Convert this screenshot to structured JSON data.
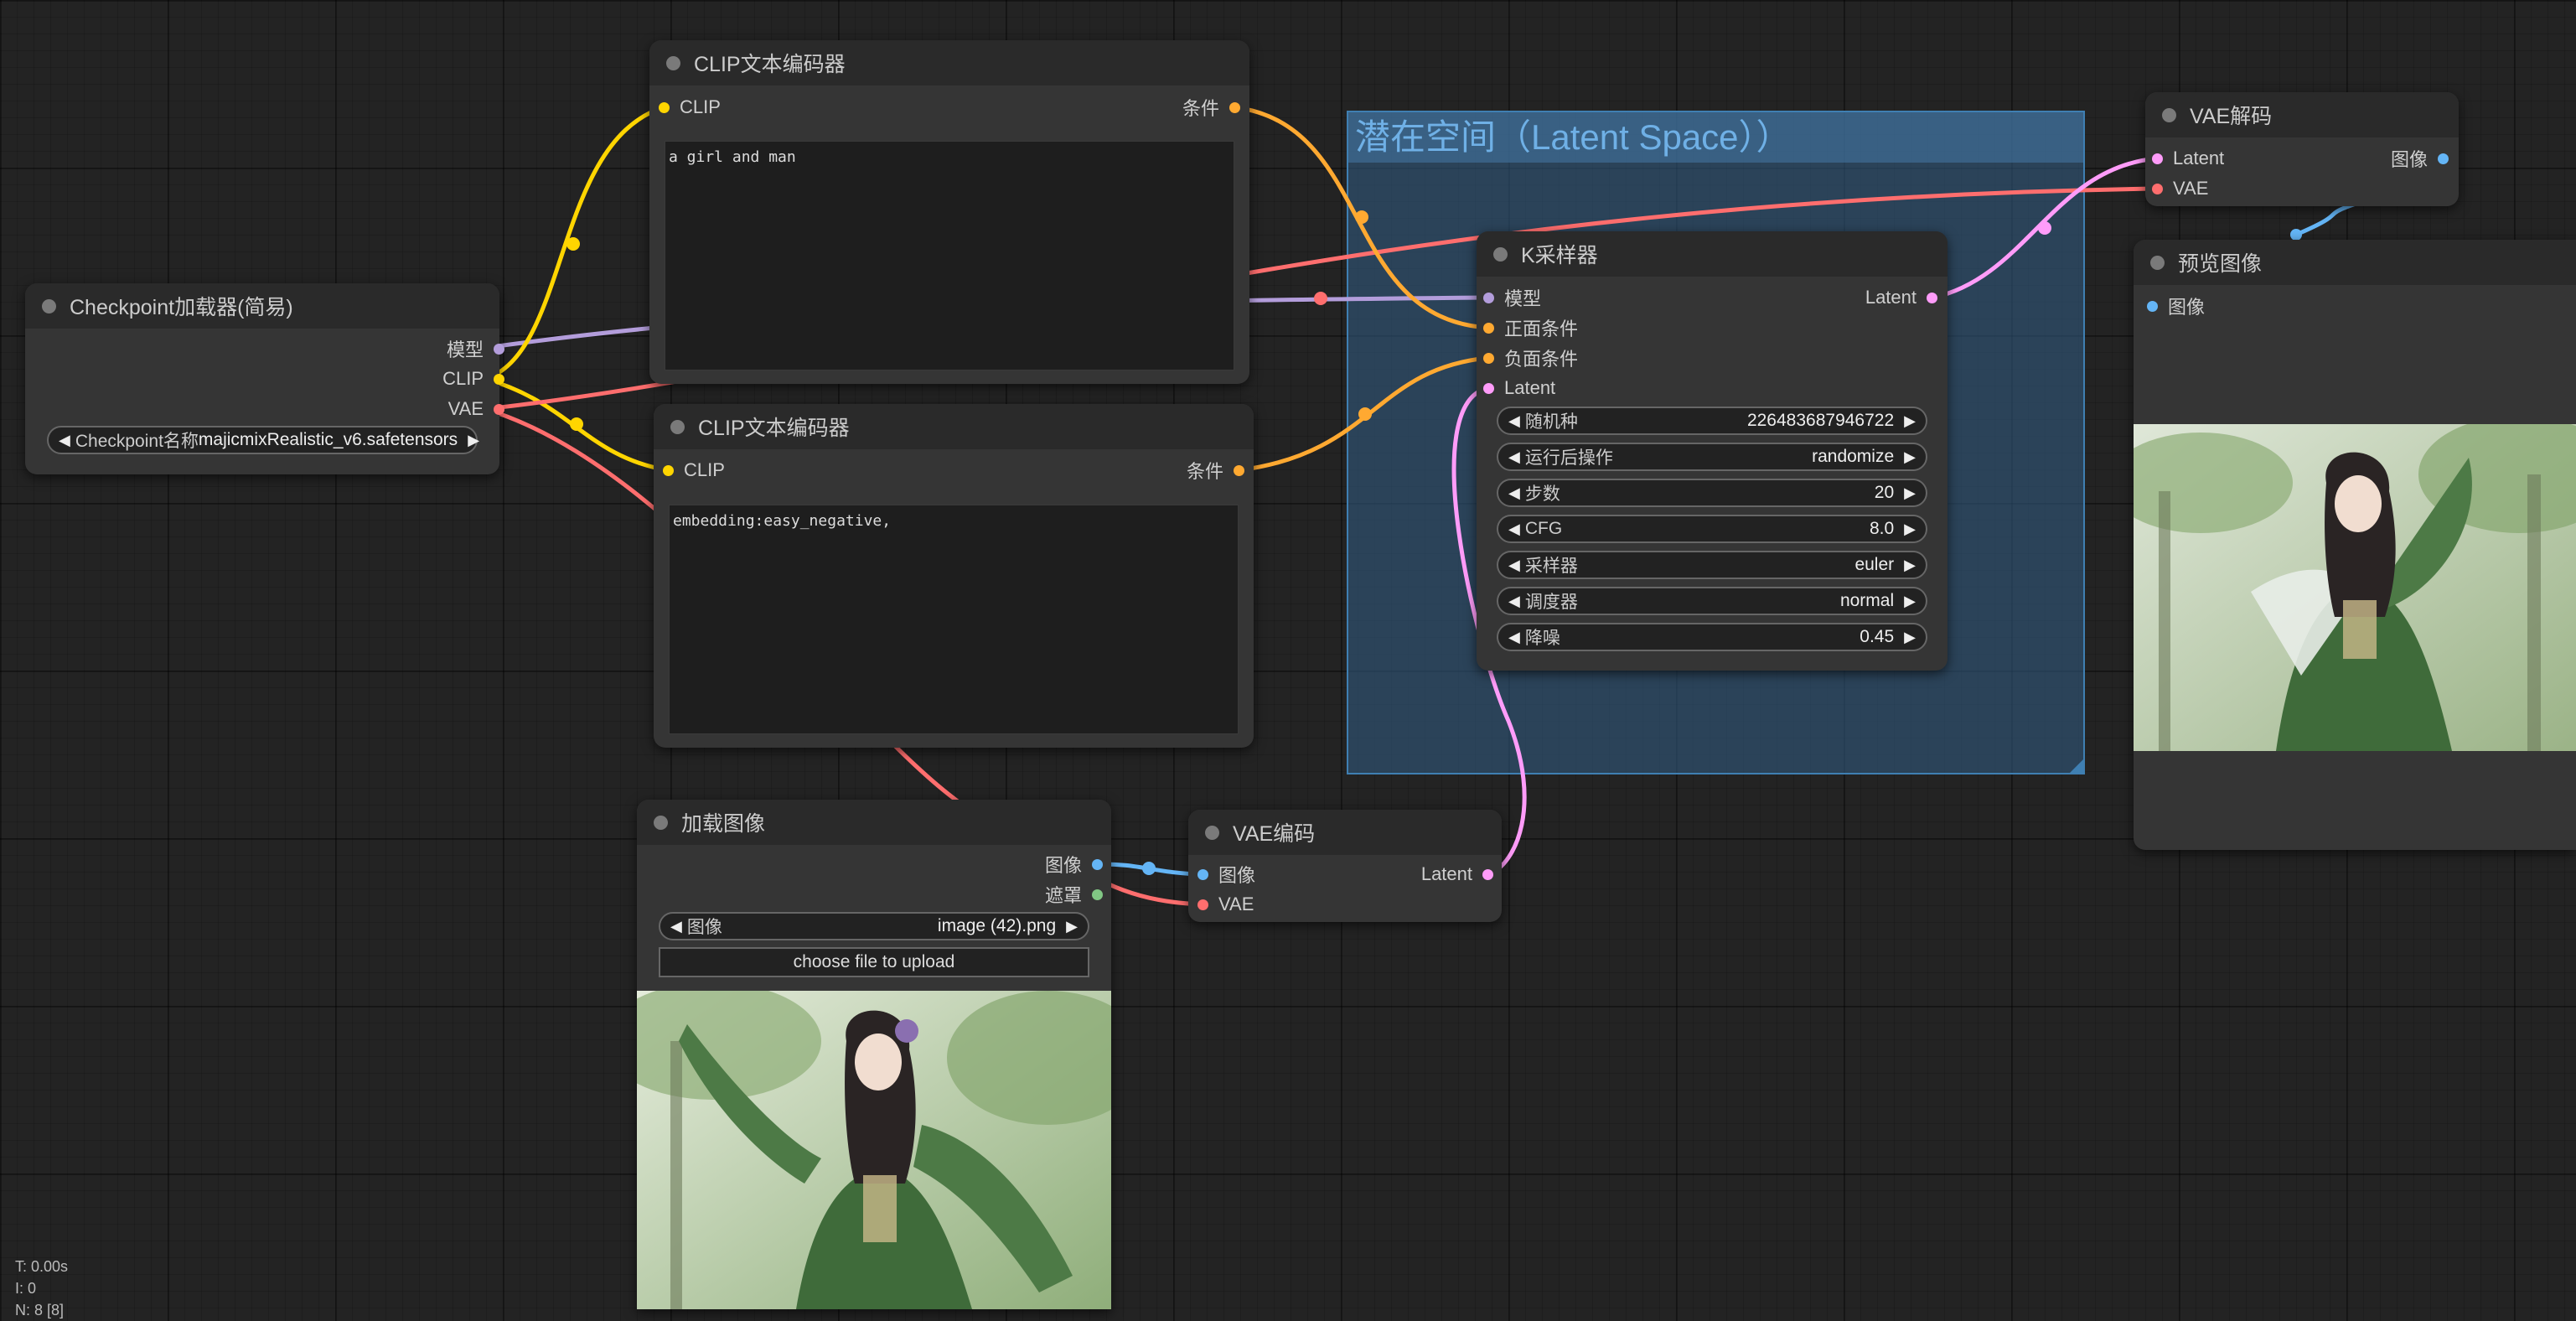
{
  "group": {
    "title": "潜在空间（Latent Space））"
  },
  "nodes": {
    "checkpoint": {
      "title": "Checkpoint加载器(简易)",
      "outputs": [
        "模型",
        "CLIP",
        "VAE"
      ],
      "widget": {
        "label": "Checkpoint名称",
        "value": "majicmixRealistic_v6.safetensors"
      }
    },
    "clip_pos": {
      "title": "CLIP文本编码器",
      "input": "CLIP",
      "output": "条件",
      "text": "a girl and man"
    },
    "clip_neg": {
      "title": "CLIP文本编码器",
      "input": "CLIP",
      "output": "条件",
      "text": "embedding:easy_negative,"
    },
    "ksampler": {
      "title": "K采样器",
      "inputs": [
        "模型",
        "正面条件",
        "负面条件",
        "Latent"
      ],
      "output": "Latent",
      "widgets": [
        {
          "label": "随机种",
          "value": "226483687946722"
        },
        {
          "label": "运行后操作",
          "value": "randomize"
        },
        {
          "label": "步数",
          "value": "20"
        },
        {
          "label": "CFG",
          "value": "8.0"
        },
        {
          "label": "采样器",
          "value": "euler"
        },
        {
          "label": "调度器",
          "value": "normal"
        },
        {
          "label": "降噪",
          "value": "0.45"
        }
      ]
    },
    "vae_decode": {
      "title": "VAE解码",
      "inputs": [
        "Latent",
        "VAE"
      ],
      "output": "图像"
    },
    "preview": {
      "title": "预览图像",
      "input": "图像"
    },
    "load_image": {
      "title": "加载图像",
      "outputs": [
        "图像",
        "遮罩"
      ],
      "widget": {
        "label": "图像",
        "value": "image (42).png"
      },
      "button": "choose file to upload"
    },
    "vae_encode": {
      "title": "VAE编码",
      "inputs": [
        "图像",
        "VAE"
      ],
      "output": "Latent"
    }
  },
  "stats": [
    "T: 0.00s",
    "I: 0",
    "N: 8 [8]"
  ],
  "colors": {
    "model": "#b39ddb",
    "clip": "#ffd500",
    "vae": "#ff6e6e",
    "conditioning": "#ffa931",
    "latent": "#ff9cf9",
    "image": "#64b5f6",
    "mask": "#81c784"
  },
  "icons": {
    "arrow_left": "arrow-left-icon",
    "arrow_right": "arrow-right-icon",
    "title_dot": "node-status-dot-icon"
  }
}
